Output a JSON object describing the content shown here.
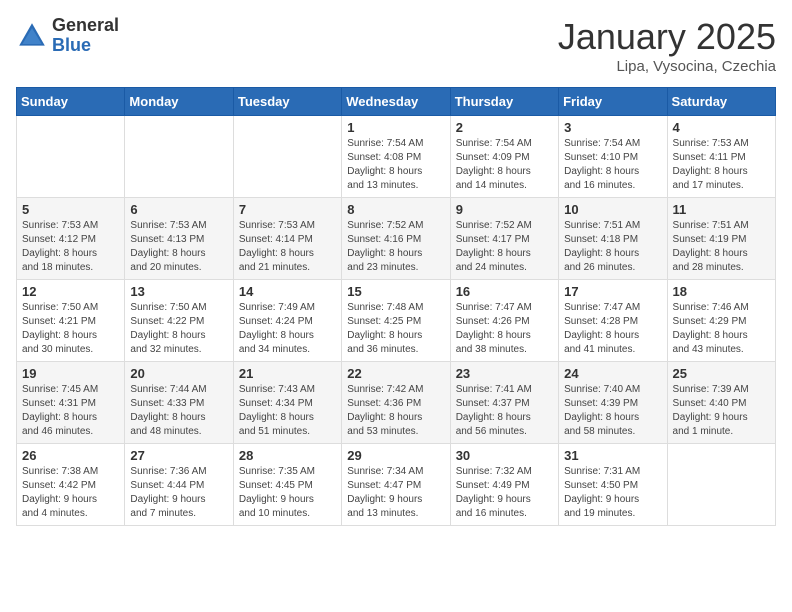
{
  "header": {
    "logo_general": "General",
    "logo_blue": "Blue",
    "title": "January 2025",
    "subtitle": "Lipa, Vysocina, Czechia"
  },
  "weekdays": [
    "Sunday",
    "Monday",
    "Tuesday",
    "Wednesday",
    "Thursday",
    "Friday",
    "Saturday"
  ],
  "weeks": [
    [
      {
        "day": "",
        "info": ""
      },
      {
        "day": "",
        "info": ""
      },
      {
        "day": "",
        "info": ""
      },
      {
        "day": "1",
        "info": "Sunrise: 7:54 AM\nSunset: 4:08 PM\nDaylight: 8 hours\nand 13 minutes."
      },
      {
        "day": "2",
        "info": "Sunrise: 7:54 AM\nSunset: 4:09 PM\nDaylight: 8 hours\nand 14 minutes."
      },
      {
        "day": "3",
        "info": "Sunrise: 7:54 AM\nSunset: 4:10 PM\nDaylight: 8 hours\nand 16 minutes."
      },
      {
        "day": "4",
        "info": "Sunrise: 7:53 AM\nSunset: 4:11 PM\nDaylight: 8 hours\nand 17 minutes."
      }
    ],
    [
      {
        "day": "5",
        "info": "Sunrise: 7:53 AM\nSunset: 4:12 PM\nDaylight: 8 hours\nand 18 minutes."
      },
      {
        "day": "6",
        "info": "Sunrise: 7:53 AM\nSunset: 4:13 PM\nDaylight: 8 hours\nand 20 minutes."
      },
      {
        "day": "7",
        "info": "Sunrise: 7:53 AM\nSunset: 4:14 PM\nDaylight: 8 hours\nand 21 minutes."
      },
      {
        "day": "8",
        "info": "Sunrise: 7:52 AM\nSunset: 4:16 PM\nDaylight: 8 hours\nand 23 minutes."
      },
      {
        "day": "9",
        "info": "Sunrise: 7:52 AM\nSunset: 4:17 PM\nDaylight: 8 hours\nand 24 minutes."
      },
      {
        "day": "10",
        "info": "Sunrise: 7:51 AM\nSunset: 4:18 PM\nDaylight: 8 hours\nand 26 minutes."
      },
      {
        "day": "11",
        "info": "Sunrise: 7:51 AM\nSunset: 4:19 PM\nDaylight: 8 hours\nand 28 minutes."
      }
    ],
    [
      {
        "day": "12",
        "info": "Sunrise: 7:50 AM\nSunset: 4:21 PM\nDaylight: 8 hours\nand 30 minutes."
      },
      {
        "day": "13",
        "info": "Sunrise: 7:50 AM\nSunset: 4:22 PM\nDaylight: 8 hours\nand 32 minutes."
      },
      {
        "day": "14",
        "info": "Sunrise: 7:49 AM\nSunset: 4:24 PM\nDaylight: 8 hours\nand 34 minutes."
      },
      {
        "day": "15",
        "info": "Sunrise: 7:48 AM\nSunset: 4:25 PM\nDaylight: 8 hours\nand 36 minutes."
      },
      {
        "day": "16",
        "info": "Sunrise: 7:47 AM\nSunset: 4:26 PM\nDaylight: 8 hours\nand 38 minutes."
      },
      {
        "day": "17",
        "info": "Sunrise: 7:47 AM\nSunset: 4:28 PM\nDaylight: 8 hours\nand 41 minutes."
      },
      {
        "day": "18",
        "info": "Sunrise: 7:46 AM\nSunset: 4:29 PM\nDaylight: 8 hours\nand 43 minutes."
      }
    ],
    [
      {
        "day": "19",
        "info": "Sunrise: 7:45 AM\nSunset: 4:31 PM\nDaylight: 8 hours\nand 46 minutes."
      },
      {
        "day": "20",
        "info": "Sunrise: 7:44 AM\nSunset: 4:33 PM\nDaylight: 8 hours\nand 48 minutes."
      },
      {
        "day": "21",
        "info": "Sunrise: 7:43 AM\nSunset: 4:34 PM\nDaylight: 8 hours\nand 51 minutes."
      },
      {
        "day": "22",
        "info": "Sunrise: 7:42 AM\nSunset: 4:36 PM\nDaylight: 8 hours\nand 53 minutes."
      },
      {
        "day": "23",
        "info": "Sunrise: 7:41 AM\nSunset: 4:37 PM\nDaylight: 8 hours\nand 56 minutes."
      },
      {
        "day": "24",
        "info": "Sunrise: 7:40 AM\nSunset: 4:39 PM\nDaylight: 8 hours\nand 58 minutes."
      },
      {
        "day": "25",
        "info": "Sunrise: 7:39 AM\nSunset: 4:40 PM\nDaylight: 9 hours\nand 1 minute."
      }
    ],
    [
      {
        "day": "26",
        "info": "Sunrise: 7:38 AM\nSunset: 4:42 PM\nDaylight: 9 hours\nand 4 minutes."
      },
      {
        "day": "27",
        "info": "Sunrise: 7:36 AM\nSunset: 4:44 PM\nDaylight: 9 hours\nand 7 minutes."
      },
      {
        "day": "28",
        "info": "Sunrise: 7:35 AM\nSunset: 4:45 PM\nDaylight: 9 hours\nand 10 minutes."
      },
      {
        "day": "29",
        "info": "Sunrise: 7:34 AM\nSunset: 4:47 PM\nDaylight: 9 hours\nand 13 minutes."
      },
      {
        "day": "30",
        "info": "Sunrise: 7:32 AM\nSunset: 4:49 PM\nDaylight: 9 hours\nand 16 minutes."
      },
      {
        "day": "31",
        "info": "Sunrise: 7:31 AM\nSunset: 4:50 PM\nDaylight: 9 hours\nand 19 minutes."
      },
      {
        "day": "",
        "info": ""
      }
    ]
  ]
}
